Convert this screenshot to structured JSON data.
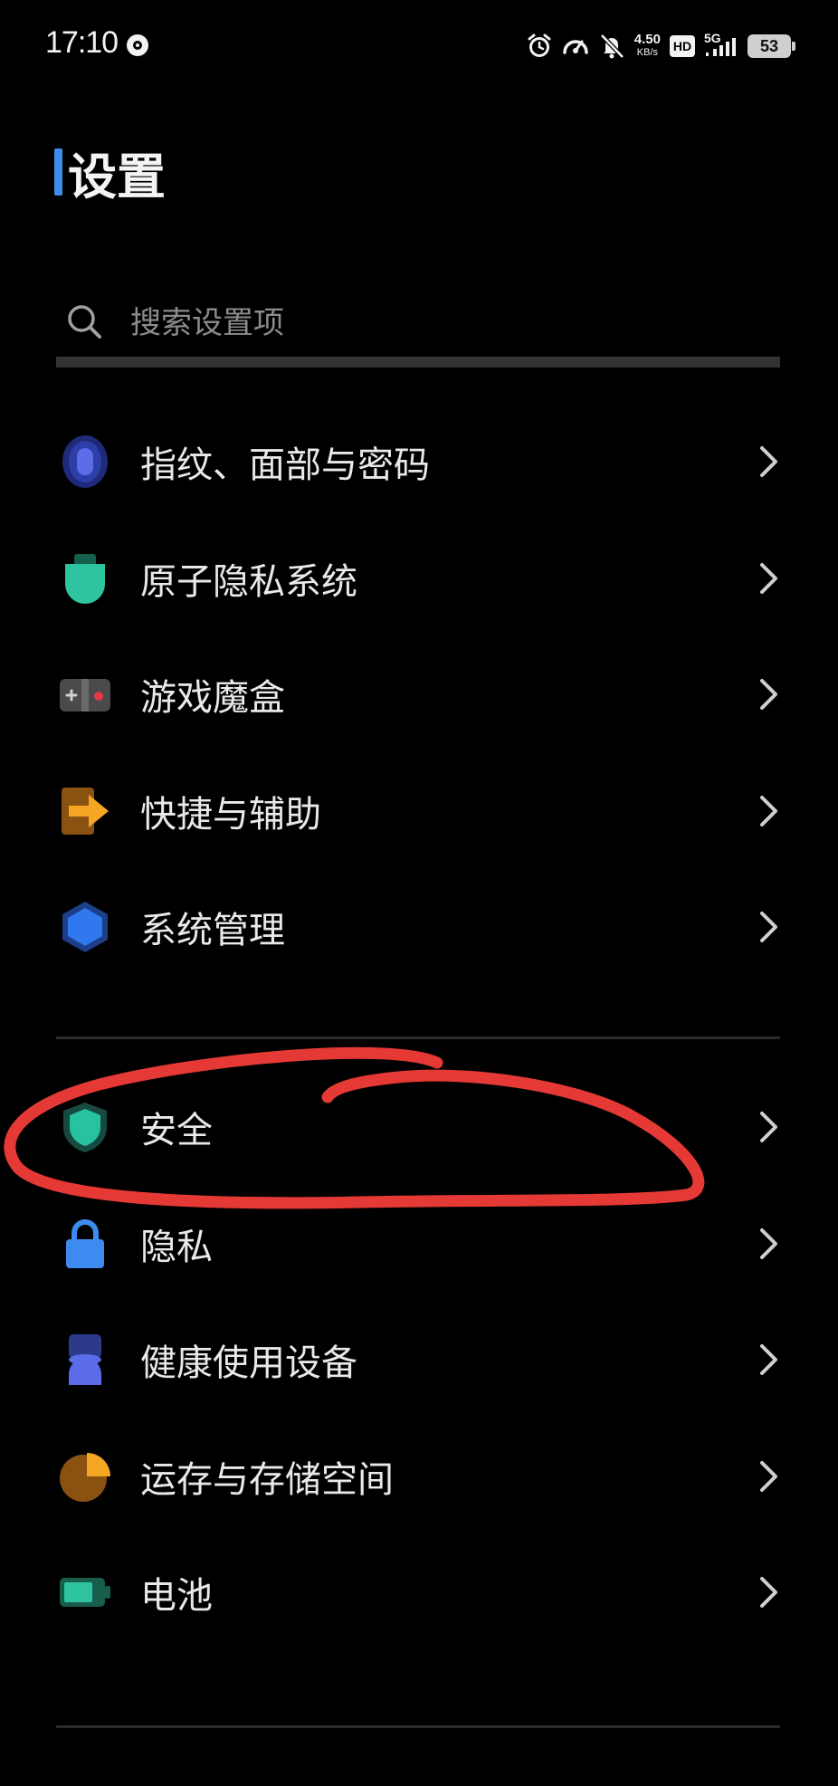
{
  "status_bar": {
    "time": "17:10",
    "net_speed_value": "4.50",
    "net_speed_unit": "KB/s",
    "hd_label": "HD",
    "network_type": "5G",
    "battery_level": "53",
    "icons": [
      "disc-icon",
      "alarm-icon",
      "speedometer-icon",
      "mute-bell-icon",
      "hd-icon",
      "signal-icon",
      "battery-icon"
    ]
  },
  "page": {
    "title": "设置"
  },
  "search": {
    "placeholder": "搜索设置项",
    "value": ""
  },
  "group_1": [
    {
      "label": "指纹、面部与密码",
      "icon": "fingerprint-icon",
      "color": "#4b5fd6"
    },
    {
      "label": "原子隐私系统",
      "icon": "atomic-privacy-icon",
      "color": "#2ec4a0"
    },
    {
      "label": "游戏魔盒",
      "icon": "gamepad-icon",
      "color": "#5a5a5a"
    },
    {
      "label": "快捷与辅助",
      "icon": "shortcut-arrow-icon",
      "color": "#f5a623"
    },
    {
      "label": "系统管理",
      "icon": "hexagon-icon",
      "color": "#2f6fe4"
    }
  ],
  "group_2": [
    {
      "label": "安全",
      "icon": "shield-icon",
      "color": "#27c2a0"
    },
    {
      "label": "隐私",
      "icon": "lock-icon",
      "color": "#3d8bf0"
    },
    {
      "label": "健康使用设备",
      "icon": "hourglass-icon",
      "color": "#5b6ce8"
    },
    {
      "label": "运存与存储空间",
      "icon": "pie-chart-icon",
      "color": "#f5a623"
    },
    {
      "label": "电池",
      "icon": "battery-icon",
      "color": "#2ec4a0"
    }
  ],
  "annotation": {
    "color": "#e53935",
    "circled_item": "安全"
  }
}
